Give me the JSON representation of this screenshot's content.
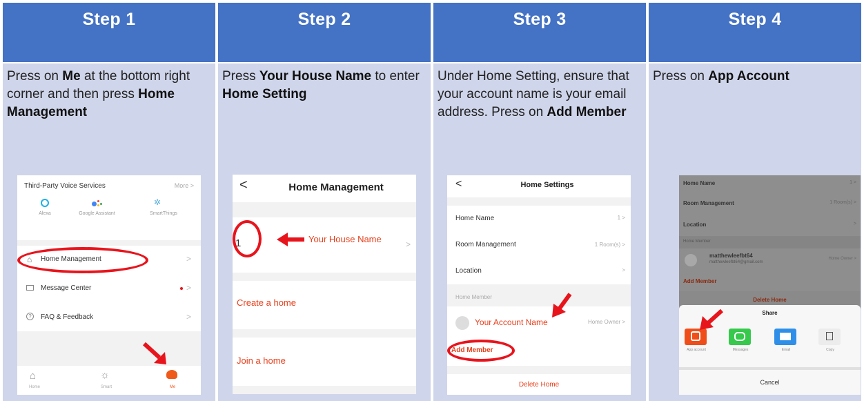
{
  "steps": [
    {
      "title": "Step 1",
      "desc_parts": [
        "Press on ",
        "Me",
        " at the bottom right corner and then press ",
        "Home Management"
      ]
    },
    {
      "title": "Step 2",
      "desc_parts": [
        "Press ",
        "Your House Name",
        " to enter ",
        "Home Setting"
      ]
    },
    {
      "title": "Step 3",
      "desc_parts": [
        "Under Home Setting, ensure that your account name is your email address. Press on ",
        "Add Member"
      ]
    },
    {
      "title": "Step 4",
      "desc_parts": [
        "Press on ",
        "App Account"
      ]
    }
  ],
  "s1": {
    "voice_title": "Third-Party Voice Services",
    "more": "More >",
    "services": [
      "Alexa",
      "Google Assistant",
      "SmartThings"
    ],
    "menu": [
      "Home Management",
      "Message Center",
      "FAQ & Feedback"
    ],
    "tabs": [
      "Home",
      "Smart",
      "Me"
    ]
  },
  "s2": {
    "back": "<",
    "title": "Home Management",
    "house_num": "1",
    "house_label": "Your House Name",
    "create": "Create a home",
    "join": "Join a home"
  },
  "s3": {
    "back": "<",
    "title": "Home Settings",
    "rows": [
      {
        "label": "Home Name",
        "value": "1 >"
      },
      {
        "label": "Room Management",
        "value": "1 Room(s) >"
      },
      {
        "label": "Location",
        "value": ">"
      }
    ],
    "member_header": "Home Member",
    "account": "Your Account Name",
    "role": "Home Owner >",
    "add": "Add Member",
    "delete": "Delete Home"
  },
  "s4": {
    "rows": [
      {
        "label": "Home Name",
        "value": "1 >"
      },
      {
        "label": "Room Management",
        "value": "1 Room(s) >"
      },
      {
        "label": "Location",
        "value": ">"
      }
    ],
    "member_header": "Home Member",
    "member_name": "matthewleefbt64",
    "member_email": "matthewleefbt64@gmail.com",
    "member_role": "Home Owner >",
    "add": "Add Member",
    "delete": "Delete Home",
    "share": "Share",
    "apps": [
      "App account",
      "Messages",
      "Email",
      "Copy"
    ],
    "cancel": "Cancel"
  },
  "colors": {
    "header": "#4472c4",
    "body": "#cfd5ea",
    "accent": "#e8401c",
    "circle": "#e8141c"
  }
}
